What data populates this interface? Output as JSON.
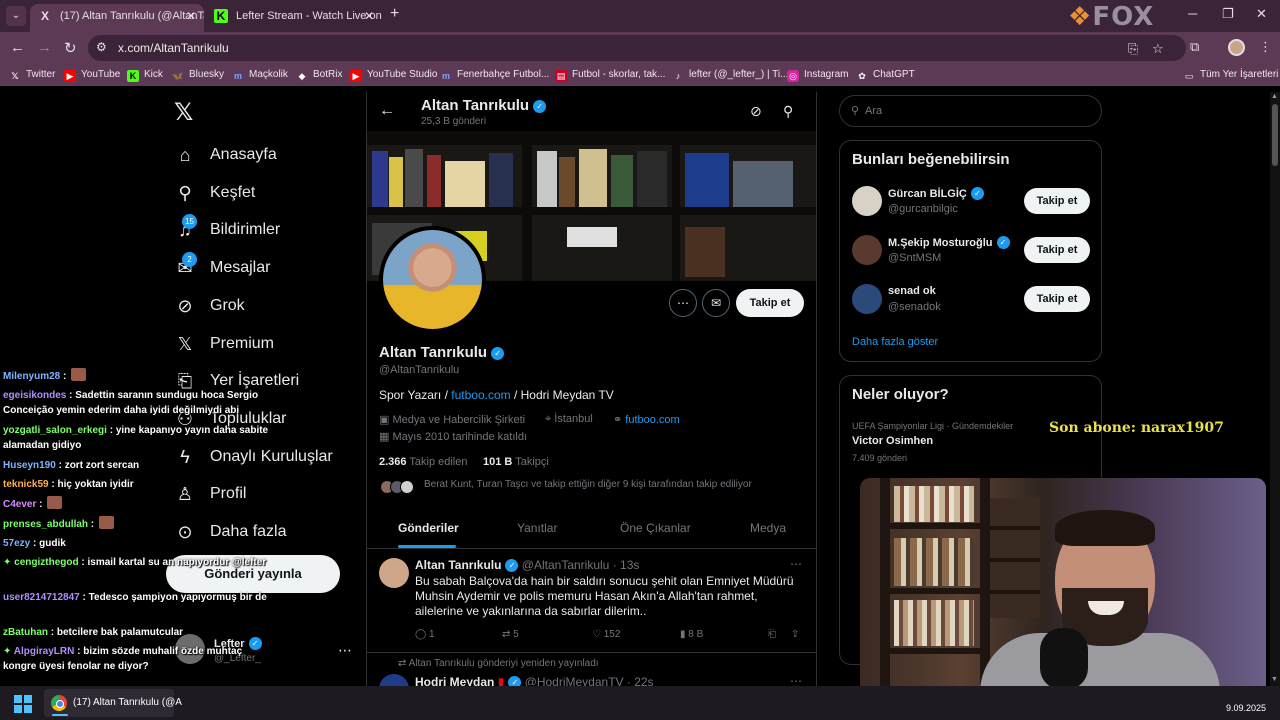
{
  "browser": {
    "tabs": [
      {
        "title": "(17) Altan Tanrıkulu (@AltanTar",
        "favicon": "X"
      },
      {
        "title": "Lefter Stream - Watch Live on K",
        "favicon": "K"
      }
    ],
    "brand_overlay": "FOX",
    "url": "x.com/AltanTanrikulu",
    "bookmarks": [
      "Twitter",
      "YouTube",
      "Kick",
      "Bluesky",
      "Maçkolik",
      "BotRix",
      "YouTube Studio",
      "Fenerbahçe Futbol...",
      "Futbol - skorlar, tak...",
      "lefter (@_lefter_) | Ti...",
      "Instagram",
      "ChatGPT"
    ],
    "all_bookmarks": "Tüm Yer İşaretleri"
  },
  "nav": {
    "items": [
      {
        "label": "Anasayfa",
        "icon": "home-icon"
      },
      {
        "label": "Keşfet",
        "icon": "search-icon"
      },
      {
        "label": "Bildirimler",
        "icon": "bell-icon"
      },
      {
        "label": "Mesajlar",
        "icon": "mail-icon"
      },
      {
        "label": "Grok",
        "icon": "grok-icon"
      },
      {
        "label": "Premium",
        "icon": "x-icon"
      },
      {
        "label": "Yer İşaretleri",
        "icon": "bookmark-icon"
      },
      {
        "label": "Topluluklar",
        "icon": "people-icon"
      },
      {
        "label": "Onaylı Kuruluşlar",
        "icon": "lightning-icon"
      },
      {
        "label": "Profil",
        "icon": "person-icon"
      },
      {
        "label": "Daha fazla",
        "icon": "more-circle-icon"
      }
    ],
    "notif_badge": "15",
    "msg_badge": "2",
    "post_button": "Gönderi yayınla",
    "account_name": "Lefter",
    "account_handle": "@_Lefter_"
  },
  "profile": {
    "header_name": "Altan Tanrıkulu",
    "post_count": "25,3 B gönderi",
    "name": "Altan Tanrıkulu",
    "handle": "@AltanTanrikulu",
    "bio_prefix": "Spor Yazarı / ",
    "bio_link": "futboo.com",
    "bio_suffix": " / Hodri Meydan TV",
    "category": "Medya ve Habercilik Şirketi",
    "location": "İstanbul",
    "website": "futboo.com",
    "joined": "Mayıs 2010 tarihinde katıldı",
    "following_count": "2.366",
    "following_label": "Takip edilen",
    "followers_count": "101 B",
    "followers_label": "Takipçi",
    "followed_by": "Berat Kunt, Turan Taşcı ve takip ettiğin diğer 9 kişi tarafından takip ediliyor",
    "follow_button": "Takip et",
    "tabs": [
      "Gönderiler",
      "Yanıtlar",
      "Öne Çıkanlar",
      "Medya"
    ]
  },
  "tweets": [
    {
      "name": "Altan Tanrıkulu",
      "handle": "@AltanTanrikulu",
      "time": "13s",
      "text": "Bu sabah Balçova'da hain bir saldırı sonucu şehit olan Emniyet Müdürü Muhsin Aydemir ve polis memuru Hasan Akın'a Allah'tan rahmet, ailelerine ve yakınlarına da sabırlar  dilerim..",
      "replies": "1",
      "reposts": "5",
      "likes": "152",
      "views": "8 B"
    }
  ],
  "repost_note": "Altan Tanrıkulu gönderiyi yeniden yayınladı",
  "tweet2": {
    "name": "Hodri Meydan",
    "handle": "@HodriMeydanTV",
    "time": "22s"
  },
  "sidebar": {
    "search_placeholder": "Ara",
    "who_to_follow_title": "Bunları beğenebilirsin",
    "suggestions": [
      {
        "name": "Gürcan BİLGİÇ",
        "handle": "@gurcanbilgic",
        "button": "Takip et",
        "verified": true
      },
      {
        "name": "M.Şekip Mosturoğlu",
        "handle": "@SntMSM",
        "button": "Takip et",
        "verified": true
      },
      {
        "name": "senad ok",
        "handle": "@senadok",
        "button": "Takip et",
        "verified": false
      }
    ],
    "show_more": "Daha fazla göster",
    "trends_title": "Neler oluyor?",
    "trends": [
      {
        "category": "UEFA Şampiyonlar Ligi · Gündemdekiler",
        "title": "Victor Osimhen",
        "count": "7.409 gönderi"
      }
    ]
  },
  "stream_overlay": {
    "chat": [
      {
        "user": "Milenyum28",
        "color": "#7fb2ff",
        "text": "",
        "emote": true
      },
      {
        "user": "egeisikondes",
        "color": "#b38cff",
        "text": " : Sadettin saranın sundugu hoca Sergio Conceição yemin ederim daha iyidi değilmiydi abi",
        "emote": false
      },
      {
        "user": "yozgatli_salon_erkegi",
        "color": "#7cff6a",
        "text": " : yine kapanıyo yayın daha sabite alamadan gidiyo",
        "emote": false
      },
      {
        "user": "Huseyn190",
        "color": "#7fb2ff",
        "text": " : zort zort sercan",
        "emote": false
      },
      {
        "user": "teknick59",
        "color": "#ffb347",
        "text": " : hiç yoktan iyidir",
        "emote": false
      },
      {
        "user": "C4ever",
        "color": "#d38cff",
        "text": " :",
        "emote": true
      },
      {
        "user": "prenses_abdullah",
        "color": "#7cff6a",
        "text": " :",
        "emote": true
      },
      {
        "user": "57ezy",
        "color": "#7fb2ff",
        "text": " : gudik",
        "emote": false
      },
      {
        "user": "cengizthegod",
        "color": "#7cff6a",
        "text": " : ismail kartal su an napıyordur @lefter",
        "emote": false
      },
      {
        "user": "user8214712847",
        "color": "#b38cff",
        "text": " : Tedesco şampiyon yapıyormuş bir de",
        "emote": false
      },
      {
        "user": "zBatuhan",
        "color": "#7cff6a",
        "text": " : betcilere bak palamutcular",
        "emote": false
      },
      {
        "user": "AlpgirayLRN",
        "color": "#b38cff",
        "text": " : bizim sözde muhalif özde muhtaç kongre üyesi fenolar ne diyor?",
        "emote": false
      }
    ],
    "last_sub": "Son abone: narax1907"
  },
  "taskbar": {
    "app_label": "(17) Altan Tanrıkulu (@A",
    "date": "9.09.2025"
  }
}
